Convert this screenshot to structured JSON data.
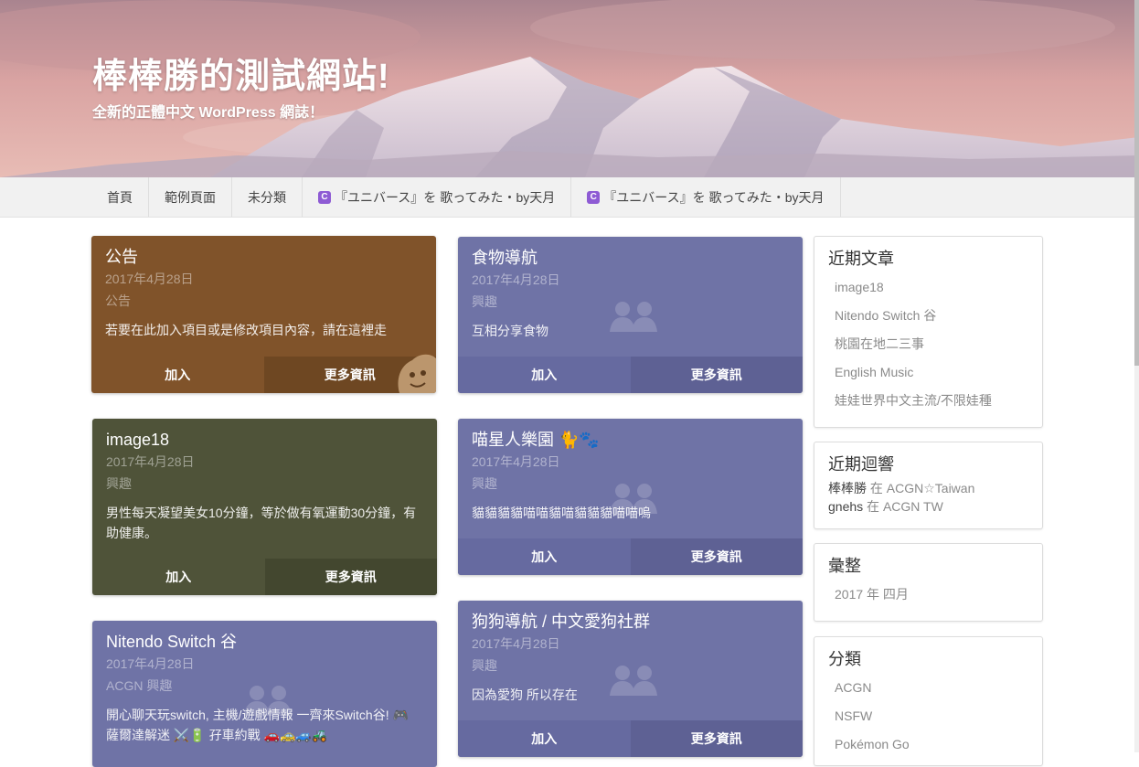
{
  "site": {
    "title": "棒棒勝的測試網站!",
    "tagline": "全新的正體中文 WordPress 網誌！"
  },
  "nav": {
    "items": [
      {
        "label": "首頁"
      },
      {
        "label": "範例頁面"
      },
      {
        "label": "未分類"
      },
      {
        "label": "『ユニバース』を 歌ってみた・by天月",
        "icon": "music-app-icon",
        "icon_glyph": "C"
      },
      {
        "label": "『ユニバース』を 歌ってみた・by天月",
        "icon": "music-app-icon",
        "icon_glyph": "C"
      }
    ]
  },
  "cards": [
    {
      "title": "公告",
      "date": "2017年4月28日",
      "category": "公告",
      "description": "若要在此加入項目或是修改項目內容，請在這裡走",
      "join": "加入",
      "more": "更多資訊",
      "color": "#80532a"
    },
    {
      "title": "image18",
      "date": "2017年4月28日",
      "category": "興趣",
      "description": "男性每天凝望美女10分鐘，等於做有氧運動30分鐘，有助健康。",
      "join": "加入",
      "more": "更多資訊",
      "color": "#4f5339"
    },
    {
      "title": "Nitendo Switch 谷",
      "date": "2017年4月28日",
      "category": "ACGN 興趣",
      "description": "開心聊天玩switch, 主機/遊戲情報 一齊來Switch谷! 🎮 薩爾達解迷 ⚔️🔋 孖車約戰 🚗🚕🚙🚜",
      "color": "#6f73a6"
    },
    {
      "title": "食物導航",
      "date": "2017年4月28日",
      "category": "興趣",
      "description": "互相分享食物",
      "join": "加入",
      "more": "更多資訊",
      "color": "#6f73a6"
    },
    {
      "title": "喵星人樂園 🐈🐾",
      "date": "2017年4月28日",
      "category": "興趣",
      "description": "貓貓貓貓喵喵貓喵貓貓貓喵喵嗚",
      "join": "加入",
      "more": "更多資訊",
      "color": "#6f73a6"
    },
    {
      "title": "狗狗導航 / 中文愛狗社群",
      "date": "2017年4月28日",
      "category": "興趣",
      "description": "因為愛狗 所以存在",
      "join": "加入",
      "more": "更多資訊",
      "color": "#6f73a6"
    }
  ],
  "sidebar": {
    "recent_posts": {
      "title": "近期文章",
      "items": [
        "image18",
        "Nitendo Switch 谷",
        "桃園在地二三事",
        "English Music",
        "娃娃世界中文主流/不限娃種"
      ]
    },
    "recent_comments": {
      "title": "近期迴響",
      "items": [
        {
          "author": "棒棒勝",
          "in": "在",
          "post": "ACGN☆Taiwan"
        },
        {
          "author": "gnehs",
          "in": "在",
          "post": "ACGN TW"
        }
      ]
    },
    "archives": {
      "title": "彙整",
      "items": [
        "2017 年 四月"
      ]
    },
    "categories": {
      "title": "分類",
      "items": [
        "ACGN",
        "NSFW",
        "Pokémon Go"
      ]
    }
  }
}
